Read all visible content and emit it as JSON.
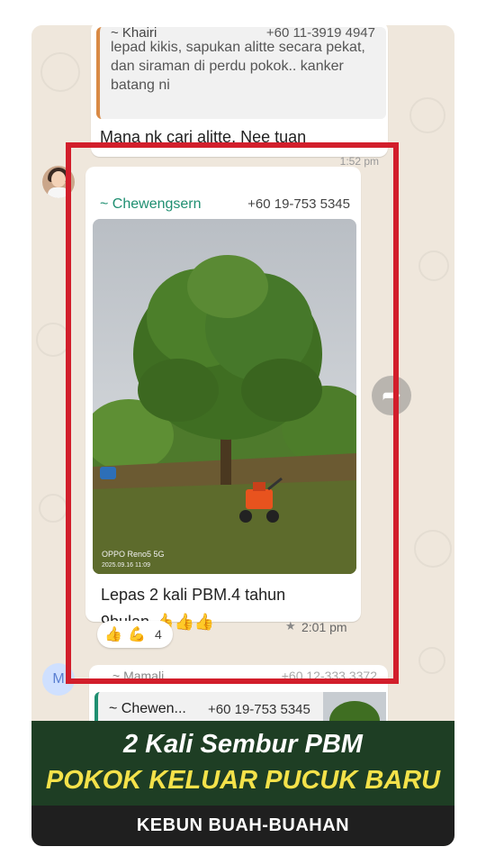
{
  "chat": {
    "prev_message": {
      "quote_name": "~ Khairi",
      "quote_number": "+60 11-3919 4947",
      "quote_text": "lepad kikis, sapukan alitte secara pekat, dan siraman di perdu pokok.. kanker batang ni",
      "text": "Mana nk cari alitte. Nee tuan",
      "time": "1:52 pm"
    },
    "main_message": {
      "sender": "~ Chewengsern",
      "number": "+60 19-753 5345",
      "photo_watermark_device": "OPPO Reno5 5G",
      "photo_watermark_date": "2025.09.16 11:09",
      "caption_line1": "Lepas 2 kali PBM.4 tahun",
      "caption_line2": "9bulan.👍👍👍",
      "star_icon": "★",
      "time": "2:01 pm"
    },
    "reactions": {
      "emoji1": "👍",
      "emoji2": "💪",
      "count": "4"
    },
    "next_message": {
      "avatar_letter": "M",
      "sender": "~ Mamali",
      "date": "+60 12-333 3372",
      "quote_name": "~ Chewen...",
      "quote_number": "+60 19-753 5345"
    }
  },
  "banner": {
    "title_line1": "2 Kali Sembur PBM",
    "title_line2": "POKOK KELUAR PUCUK BARU",
    "footer": "KEBUN BUAH-BUAHAN"
  },
  "colors": {
    "highlight_border": "#d21e2b",
    "banner_bg": "#1e3e24",
    "title_yellow": "#f4e24a",
    "sender_green": "#1f8f71"
  }
}
